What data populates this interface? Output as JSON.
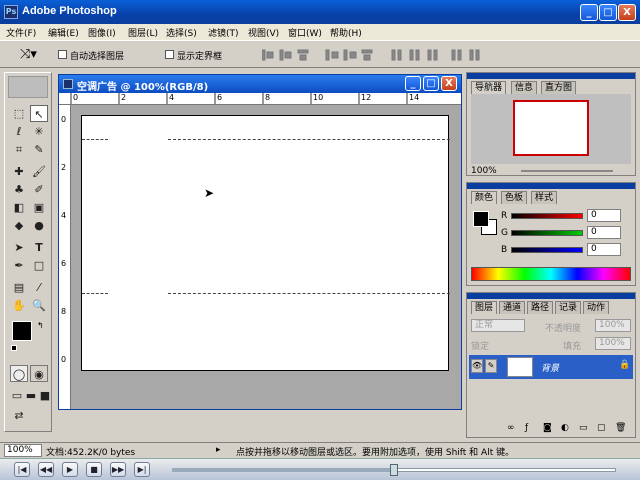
{
  "app": {
    "title": "Adobe Photoshop",
    "icon_label": "Ps"
  },
  "window_controls": {
    "minimize": "_",
    "maximize": "□",
    "close": "X"
  },
  "menu": [
    "文件(F)",
    "编辑(E)",
    "图像(I)",
    "图层(L)",
    "选择(S)",
    "滤镜(T)",
    "视图(V)",
    "窗口(W)",
    "帮助(H)"
  ],
  "options": {
    "auto_select_label": "自动选择图层",
    "show_bounds_label": "显示定界框"
  },
  "document": {
    "title": "空调广告 @ 100%(RGB/8)",
    "ruler_top": [
      "0",
      "2",
      "4",
      "6",
      "8",
      "10",
      "12",
      "14"
    ],
    "ruler_left": [
      "0",
      "2",
      "4",
      "6",
      "8",
      "0"
    ]
  },
  "navigator": {
    "tabs": [
      "导航器",
      "信息",
      "直方图"
    ],
    "zoom": "100%"
  },
  "color": {
    "tabs": [
      "颜色",
      "色板",
      "样式"
    ],
    "r_label": "R",
    "g_label": "G",
    "b_label": "B",
    "r_value": "0",
    "g_value": "0",
    "b_value": "0"
  },
  "layers": {
    "tabs": [
      "图层",
      "通道",
      "路径",
      "记录",
      "动作"
    ],
    "blend_mode": "正常",
    "opacity_label": "不透明度",
    "opacity_value": "100%",
    "lock_label": "锁定",
    "fill_label": "填充",
    "fill_value": "100%",
    "layer_name": "背景"
  },
  "status": {
    "zoom": "100%",
    "doc_size": "文档:452.2K/0 bytes",
    "hint": "点按并拖移以移动图层或选区。要用附加选项，使用 Shift 和 Alt 键。"
  },
  "colors": {
    "titlebar": "#0a5fd8",
    "foreground": "#000000",
    "background": "#ffffff",
    "red_slider": "#cc0000",
    "green_slider": "#00aa00",
    "blue_slider": "#0000cc",
    "selected_layer": "#2a5fc8"
  },
  "player": {
    "progress": 0.5
  }
}
